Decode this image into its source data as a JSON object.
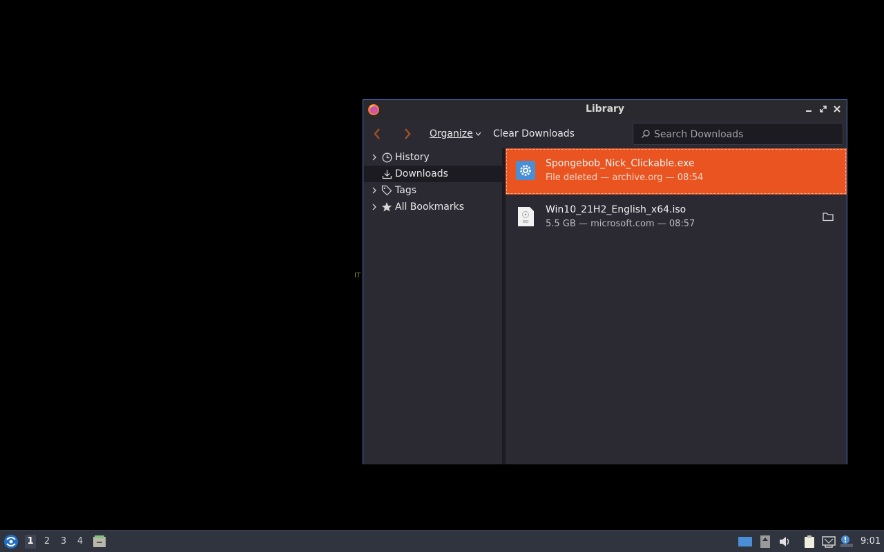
{
  "desktop": {
    "stray_text": "IT"
  },
  "window": {
    "title": "Library",
    "controls": [
      "minimize",
      "maximize",
      "close"
    ]
  },
  "toolbar": {
    "organize_label": "Organize",
    "clear_label": "Clear Downloads",
    "search_placeholder": "Search Downloads"
  },
  "sidebar": {
    "items": [
      {
        "label": "History",
        "icon": "clock-icon",
        "expandable": true
      },
      {
        "label": "Downloads",
        "icon": "download-icon",
        "expandable": false,
        "selected": true
      },
      {
        "label": "Tags",
        "icon": "tag-icon",
        "expandable": true
      },
      {
        "label": "All Bookmarks",
        "icon": "star-icon",
        "expandable": true
      }
    ]
  },
  "downloads": [
    {
      "name": "Spongebob_Nick_Clickable.exe",
      "status": "File deleted — archive.org — 08:54",
      "icon": "exe-gear-icon",
      "selected": true
    },
    {
      "name": "Win10_21H2_English_x64.iso",
      "status": "5.5 GB — microsoft.com — 08:57",
      "icon": "iso-file-icon",
      "selected": false
    }
  ],
  "taskbar": {
    "workspaces": [
      "1",
      "2",
      "3",
      "4"
    ],
    "active_workspace": "1",
    "clock": "9:01"
  },
  "colors": {
    "accent_selected": "#e95420",
    "window_border": "#4a79c8",
    "panel_bg": "#2b2a33"
  }
}
